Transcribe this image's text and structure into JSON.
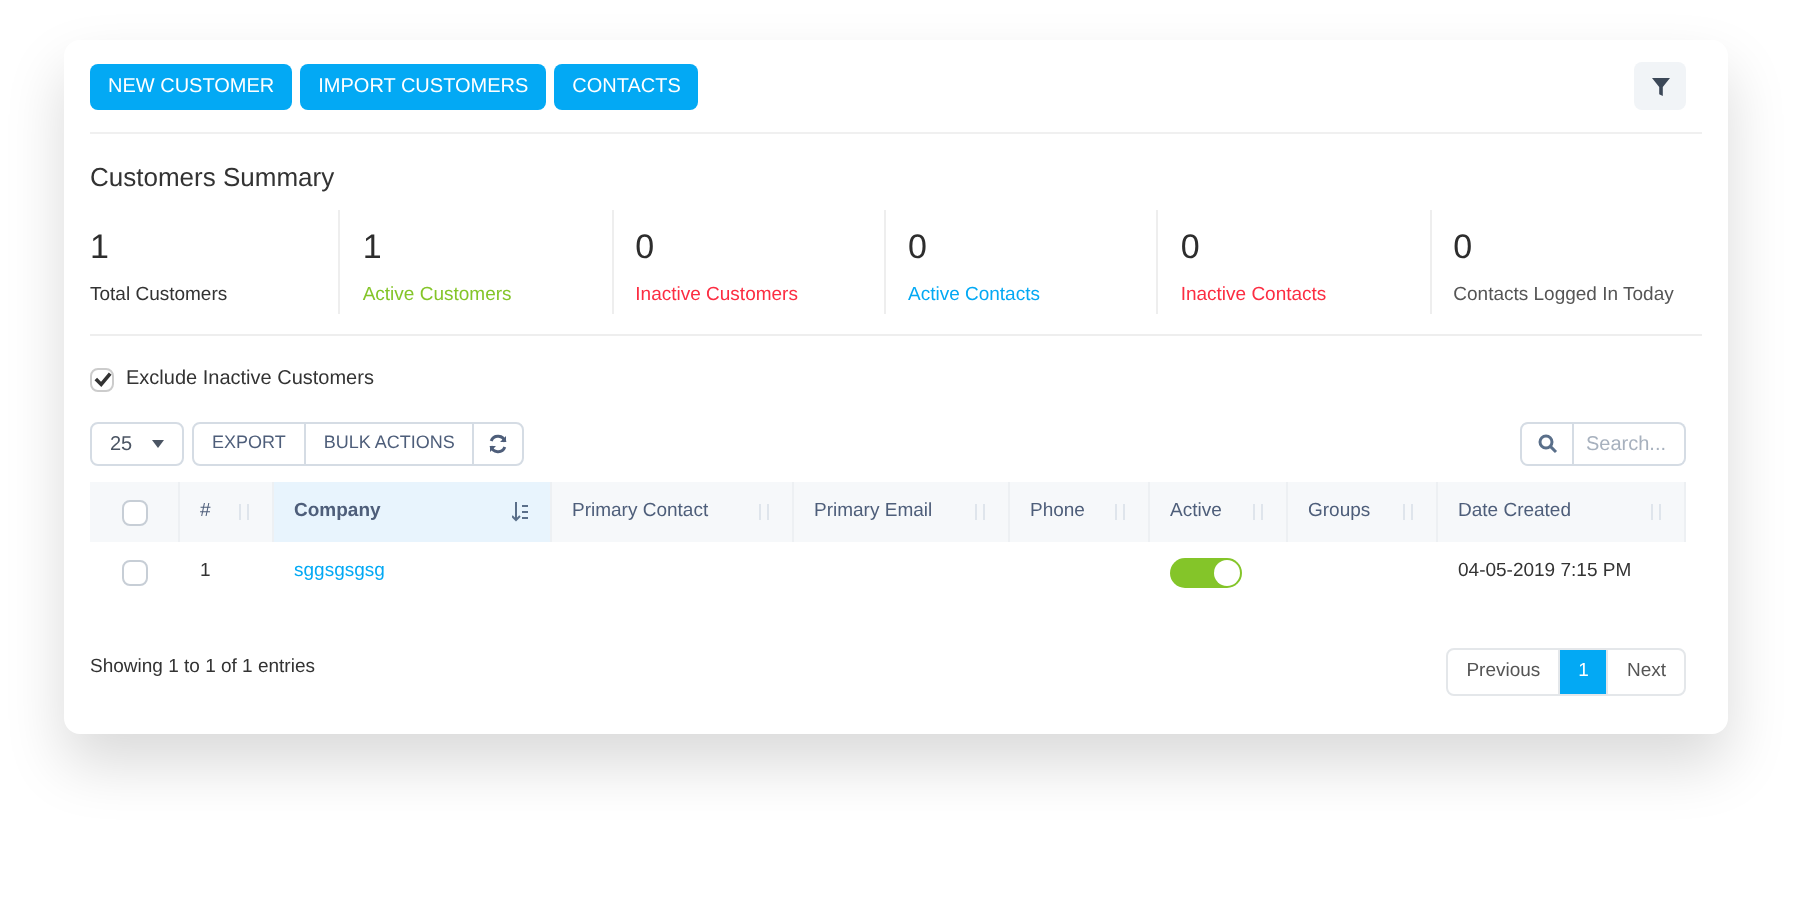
{
  "toolbar": {
    "buttons": [
      "NEW CUSTOMER",
      "IMPORT CUSTOMERS",
      "CONTACTS"
    ]
  },
  "summary": {
    "title": "Customers Summary",
    "stats": [
      {
        "value": "1",
        "label": "Total Customers",
        "color": "#333333"
      },
      {
        "value": "1",
        "label": "Active Customers",
        "color": "#84c529"
      },
      {
        "value": "0",
        "label": "Inactive Customers",
        "color": "#fc2d42"
      },
      {
        "value": "0",
        "label": "Active Contacts",
        "color": "#03a9f4"
      },
      {
        "value": "0",
        "label": "Inactive Contacts",
        "color": "#fc2d42"
      },
      {
        "value": "0",
        "label": "Contacts Logged In Today",
        "color": "#555555"
      }
    ]
  },
  "exclude_inactive": {
    "label": "Exclude Inactive Customers",
    "checked": true
  },
  "table_tools": {
    "page_size": "25",
    "buttons": [
      "EXPORT",
      "BULK ACTIONS"
    ],
    "search": {
      "placeholder": "Search..."
    }
  },
  "table": {
    "header_checked": false,
    "columns": [
      {
        "label": "#",
        "sorted": false
      },
      {
        "label": "Company",
        "sorted": true
      },
      {
        "label": "Primary Contact",
        "sorted": false
      },
      {
        "label": "Primary Email",
        "sorted": false
      },
      {
        "label": "Phone",
        "sorted": false
      },
      {
        "label": "Active",
        "sorted": false
      },
      {
        "label": "Groups",
        "sorted": false
      },
      {
        "label": "Date Created",
        "sorted": false
      }
    ],
    "rows": [
      {
        "checked": false,
        "number": "1",
        "company": "sggsgsgsg",
        "active": true,
        "date_created": "04-05-2019 7:15 PM"
      }
    ]
  },
  "footer": {
    "info": "Showing 1 to 1 of 1 entries",
    "pagination": [
      {
        "label": "Previous",
        "selected": false
      },
      {
        "label": "1",
        "selected": true
      },
      {
        "label": "Next",
        "selected": false
      }
    ]
  }
}
